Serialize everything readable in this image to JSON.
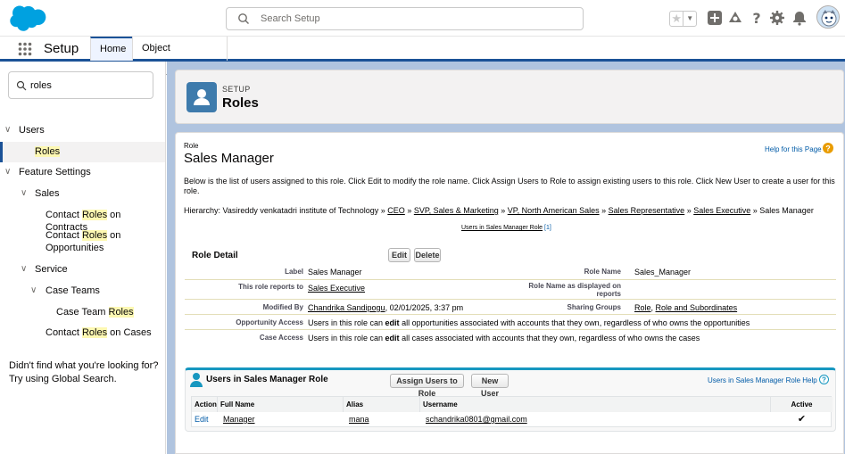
{
  "header": {
    "search_placeholder": "Search Setup"
  },
  "nav": {
    "app_name": "Setup",
    "tabs": [
      {
        "label": "Home"
      },
      {
        "label": "Object Manager"
      }
    ]
  },
  "sidebar": {
    "quickfind_value": "roles",
    "items": {
      "users": "Users",
      "roles": "Roles",
      "feature_settings": "Feature Settings",
      "sales": "Sales",
      "contact_roles_contracts_a": "Contact ",
      "contact_roles_contracts_b": "Roles",
      "contact_roles_contracts_c": " on Contracts",
      "contact_roles_opps_a": "Contact ",
      "contact_roles_opps_b": "Roles",
      "contact_roles_opps_c": " on",
      "contact_roles_opps_d": "Opportunities",
      "service": "Service",
      "case_teams": "Case Teams",
      "case_team_roles_a": "Case Team ",
      "case_team_roles_b": "Roles",
      "contact_roles_cases_a": "Contact ",
      "contact_roles_cases_b": "Roles",
      "contact_roles_cases_c": " on Cases"
    },
    "help_line1": "Didn't find what you're looking for?",
    "help_line2": "Try using Global Search."
  },
  "page_header": {
    "eyebrow": "SETUP",
    "title": "Roles"
  },
  "role": {
    "label": "Role",
    "name": "Sales Manager",
    "help_link": "Help for this Page",
    "description": "Below is the list of users assigned to this role. Click Edit to modify the role name. Click Assign Users to Role to assign existing users to this role. Click New User to create a user for this role.",
    "hierarchy_prefix": "Hierarchy: Vasireddy venkatadri institute of Technology » ",
    "hierarchy": [
      "CEO",
      "SVP, Sales & Marketing",
      "VP, North American Sales",
      "Sales Representative",
      "Sales Executive"
    ],
    "hierarchy_sep": " » ",
    "hierarchy_current": "Sales Manager",
    "users_link": "Users in Sales Manager Role",
    "users_link_count": "[1]"
  },
  "detail": {
    "heading": "Role Detail",
    "edit_btn": "Edit",
    "delete_btn": "Delete",
    "label_lbl": "Label",
    "label_val": "Sales Manager",
    "rolename_lbl": "Role Name",
    "rolename_val": "Sales_Manager",
    "reports_lbl": "This role reports to",
    "reports_val": "Sales Executive",
    "display_lbl_1": "Role Name as displayed on",
    "display_lbl_2": "reports",
    "modified_lbl": "Modified By",
    "modified_user": "Chandrika Sandipogu",
    "modified_date": ", 02/01/2025, 3:37 pm",
    "sharing_lbl": "Sharing Groups",
    "sharing_role": "Role",
    "sharing_sep": ", ",
    "sharing_subs": "Role and Subordinates",
    "opp_lbl": "Opportunity Access",
    "opp_val_a": "Users in this role can ",
    "opp_val_b": "edit",
    "opp_val_c": " all opportunities associated with accounts that they own, regardless of who owns the opportunities",
    "case_lbl": "Case Access",
    "case_val_a": "Users in this role can ",
    "case_val_b": "edit",
    "case_val_c": " all cases associated with accounts that they own, regardless of who owns the cases"
  },
  "users_section": {
    "title": "Users in Sales Manager Role",
    "assign_btn": "Assign Users to Role",
    "new_btn": "New User",
    "help_link": "Users in Sales Manager Role Help",
    "columns": [
      "Action",
      "Full Name",
      "Alias",
      "Username",
      "Active"
    ],
    "rows": [
      {
        "action": "Edit",
        "full_name": "Manager",
        "alias": "mana",
        "username": "schandrika0801@gmail.com",
        "active": "✔"
      }
    ]
  }
}
